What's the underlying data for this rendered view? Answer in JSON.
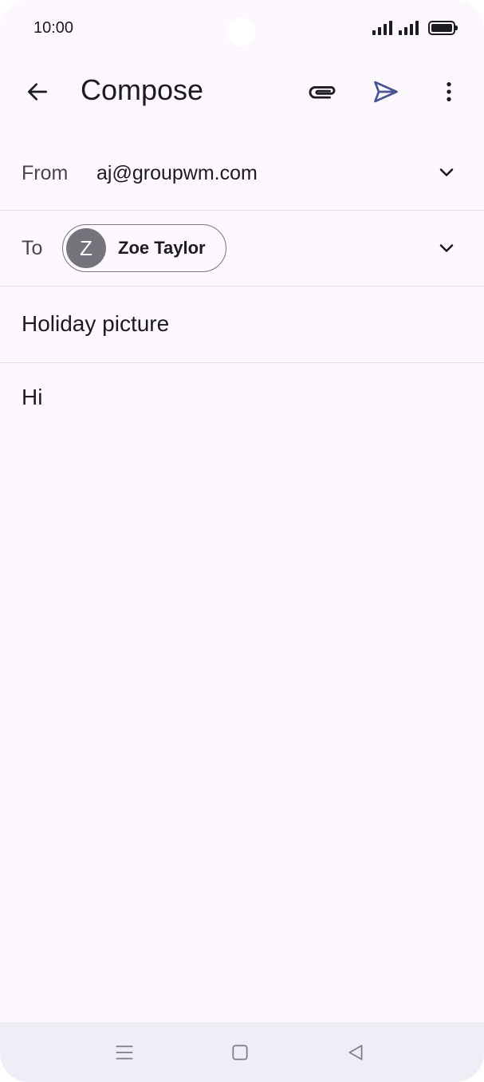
{
  "status_bar": {
    "time": "10:00"
  },
  "app_bar": {
    "title": "Compose"
  },
  "compose": {
    "from_label": "From",
    "from_value": "aj@groupwm.com",
    "to_label": "To",
    "recipient": {
      "initial": "Z",
      "name": "Zoe Taylor"
    },
    "subject": "Holiday picture",
    "body": "Hi"
  },
  "icons": {
    "back": "arrow-left-icon",
    "attach": "paperclip-icon",
    "send": "send-icon",
    "more": "more-vert-icon",
    "expand": "chevron-down-icon"
  },
  "colors": {
    "background": "#fcf8fd",
    "send_accent": "#4a5592",
    "avatar": "#75737b",
    "nav_bar": "#efedf6"
  }
}
